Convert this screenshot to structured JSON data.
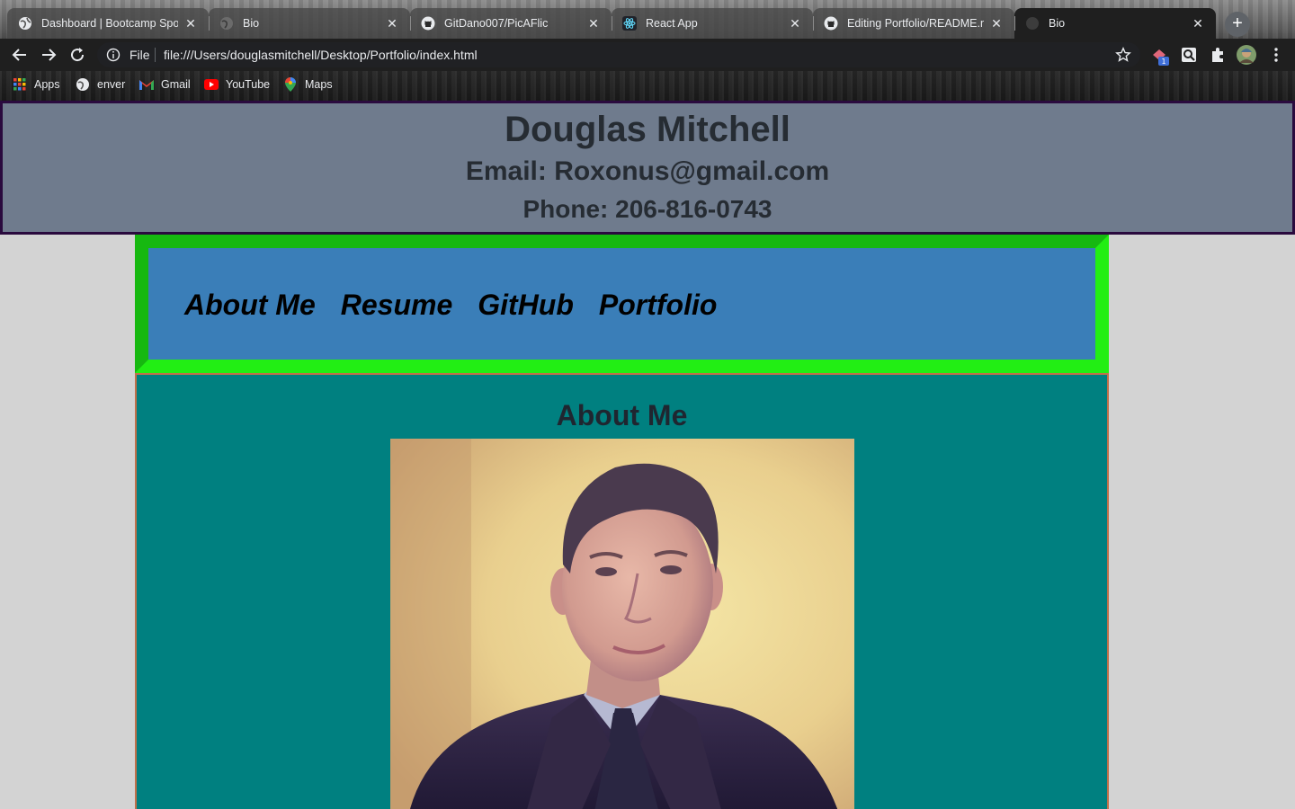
{
  "browser": {
    "tabs": [
      {
        "title": "Dashboard | Bootcamp Spot",
        "icon": "globe-icon",
        "active": false
      },
      {
        "title": "Bio",
        "icon": "globe-icon",
        "active": false
      },
      {
        "title": "GitDano007/PicAFlic",
        "icon": "github-icon",
        "active": false
      },
      {
        "title": "React App",
        "icon": "react-icon",
        "active": false
      },
      {
        "title": "Editing Portfolio/README.m",
        "icon": "github-icon",
        "active": false
      },
      {
        "title": "Bio",
        "icon": "globe-icon",
        "active": true
      }
    ],
    "close_glyph": "✕",
    "new_tab_glyph": "+",
    "address": {
      "scheme_label": "File",
      "url": "file:///Users/douglasmitchell/Desktop/Portfolio/index.html"
    },
    "extension_badge": "1",
    "bookmarks": [
      {
        "label": "Apps",
        "icon": "apps-grid-icon"
      },
      {
        "label": "enver",
        "icon": "globe-icon"
      },
      {
        "label": "Gmail",
        "icon": "gmail-icon"
      },
      {
        "label": "YouTube",
        "icon": "youtube-icon"
      },
      {
        "label": "Maps",
        "icon": "maps-pin-icon"
      }
    ]
  },
  "header": {
    "name": "Douglas Mitchell",
    "email": "Email: Roxonus@gmail.com",
    "phone": "Phone: 206-816-0743"
  },
  "nav": {
    "links": [
      "About Me",
      "Resume",
      "GitHub",
      "Portfolio"
    ]
  },
  "main": {
    "section_title": "About Me",
    "photo": "profile-photo"
  },
  "colors": {
    "header_bg": "#6f7b8d",
    "nav_bg": "#3a7eb8",
    "nav_border": "#22ee14",
    "main_bg": "#008080",
    "page_bg": "#d3d3d3"
  }
}
